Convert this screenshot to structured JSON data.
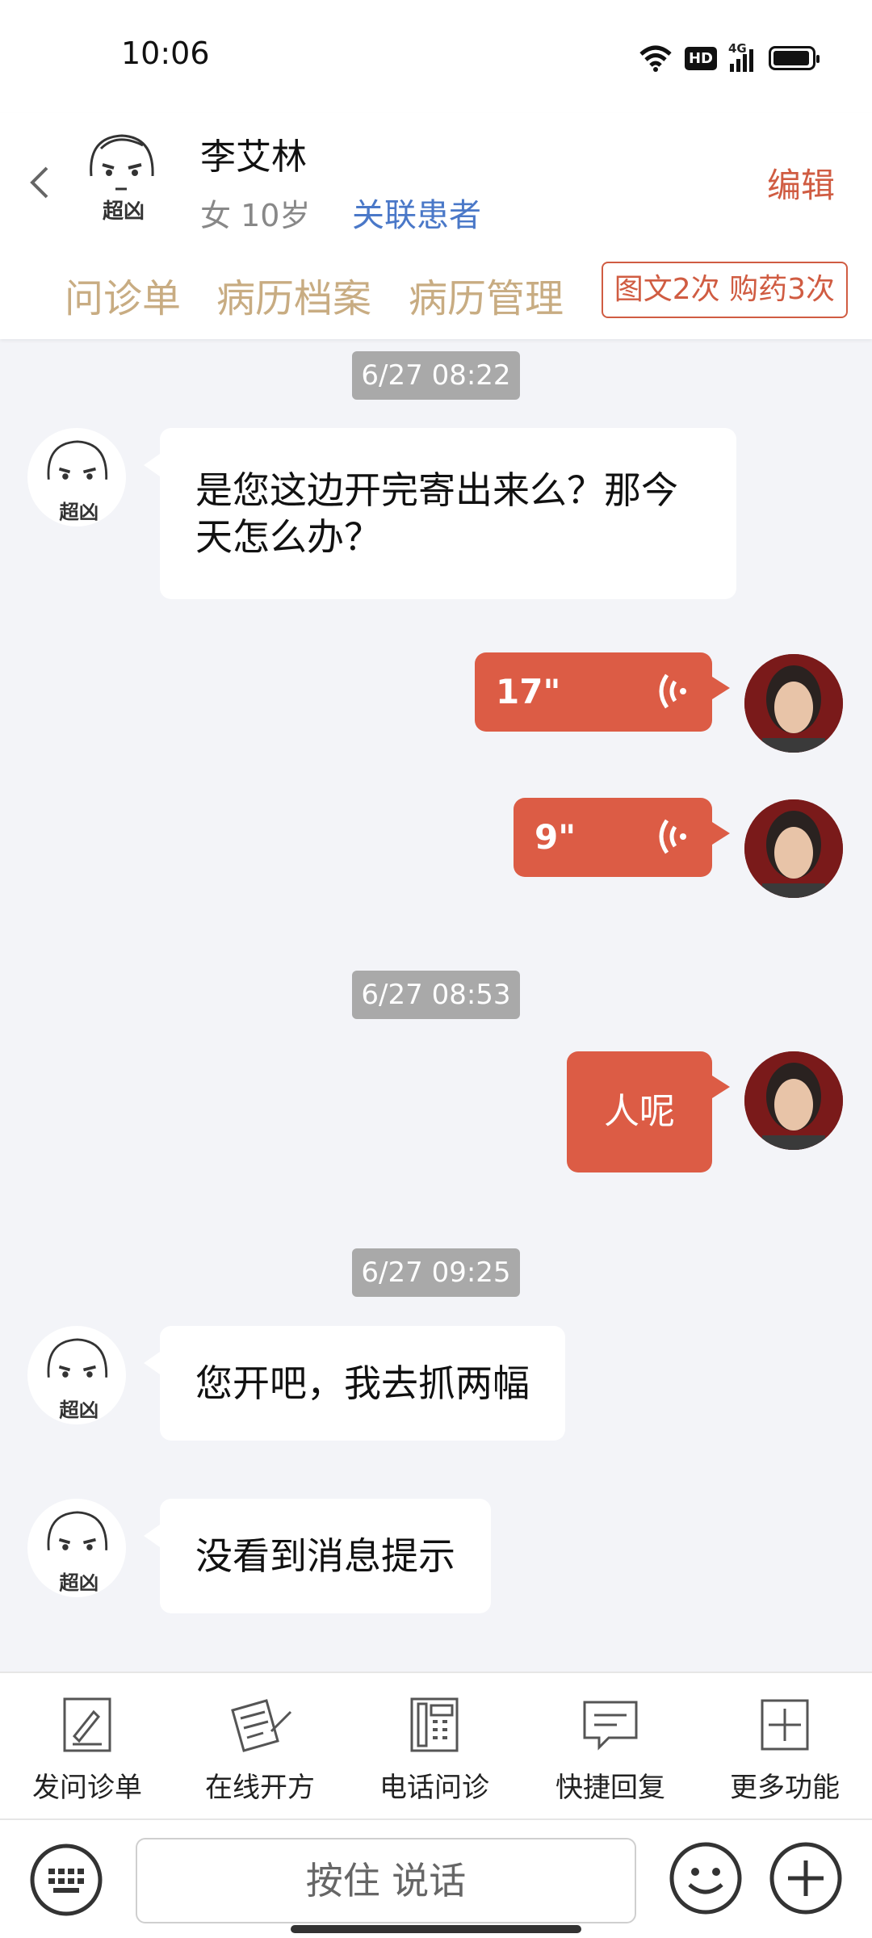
{
  "status_bar": {
    "time": "10:06",
    "network": "4G",
    "hd": "HD"
  },
  "header": {
    "patient_name": "李艾林",
    "patient_info": "女 10岁",
    "link_label": "关联患者",
    "edit_label": "编辑",
    "avatar_text": "超凶",
    "tabs": [
      "问诊单",
      "病历档案",
      "病历管理"
    ],
    "counts_badge": "图文2次 购药3次"
  },
  "messages": [
    {
      "type": "timestamp",
      "text": "6/27 08:22"
    },
    {
      "type": "text",
      "side": "left",
      "text": "是您这边开完寄出来么？那今天怎么办？"
    },
    {
      "type": "voice",
      "side": "right",
      "duration": "17\""
    },
    {
      "type": "voice",
      "side": "right",
      "duration": "9\""
    },
    {
      "type": "timestamp",
      "text": "6/27 08:53"
    },
    {
      "type": "text",
      "side": "right",
      "text": "人呢"
    },
    {
      "type": "timestamp",
      "text": "6/27 09:25"
    },
    {
      "type": "text",
      "side": "left",
      "text": "您开吧，我去抓两幅"
    },
    {
      "type": "text",
      "side": "left",
      "text": "没看到消息提示"
    }
  ],
  "functions": [
    {
      "label": "发问诊单",
      "icon": "form-icon"
    },
    {
      "label": "在线开方",
      "icon": "prescription-icon"
    },
    {
      "label": "电话问诊",
      "icon": "phone-icon"
    },
    {
      "label": "快捷回复",
      "icon": "quick-reply-icon"
    },
    {
      "label": "更多功能",
      "icon": "more-icon"
    }
  ],
  "input_bar": {
    "hold_to_talk": "按住 说话"
  },
  "colors": {
    "accent": "#dc5c45",
    "tab_text": "#c8ac82",
    "link": "#4a78c8",
    "chat_bg": "#f3f4f8"
  }
}
